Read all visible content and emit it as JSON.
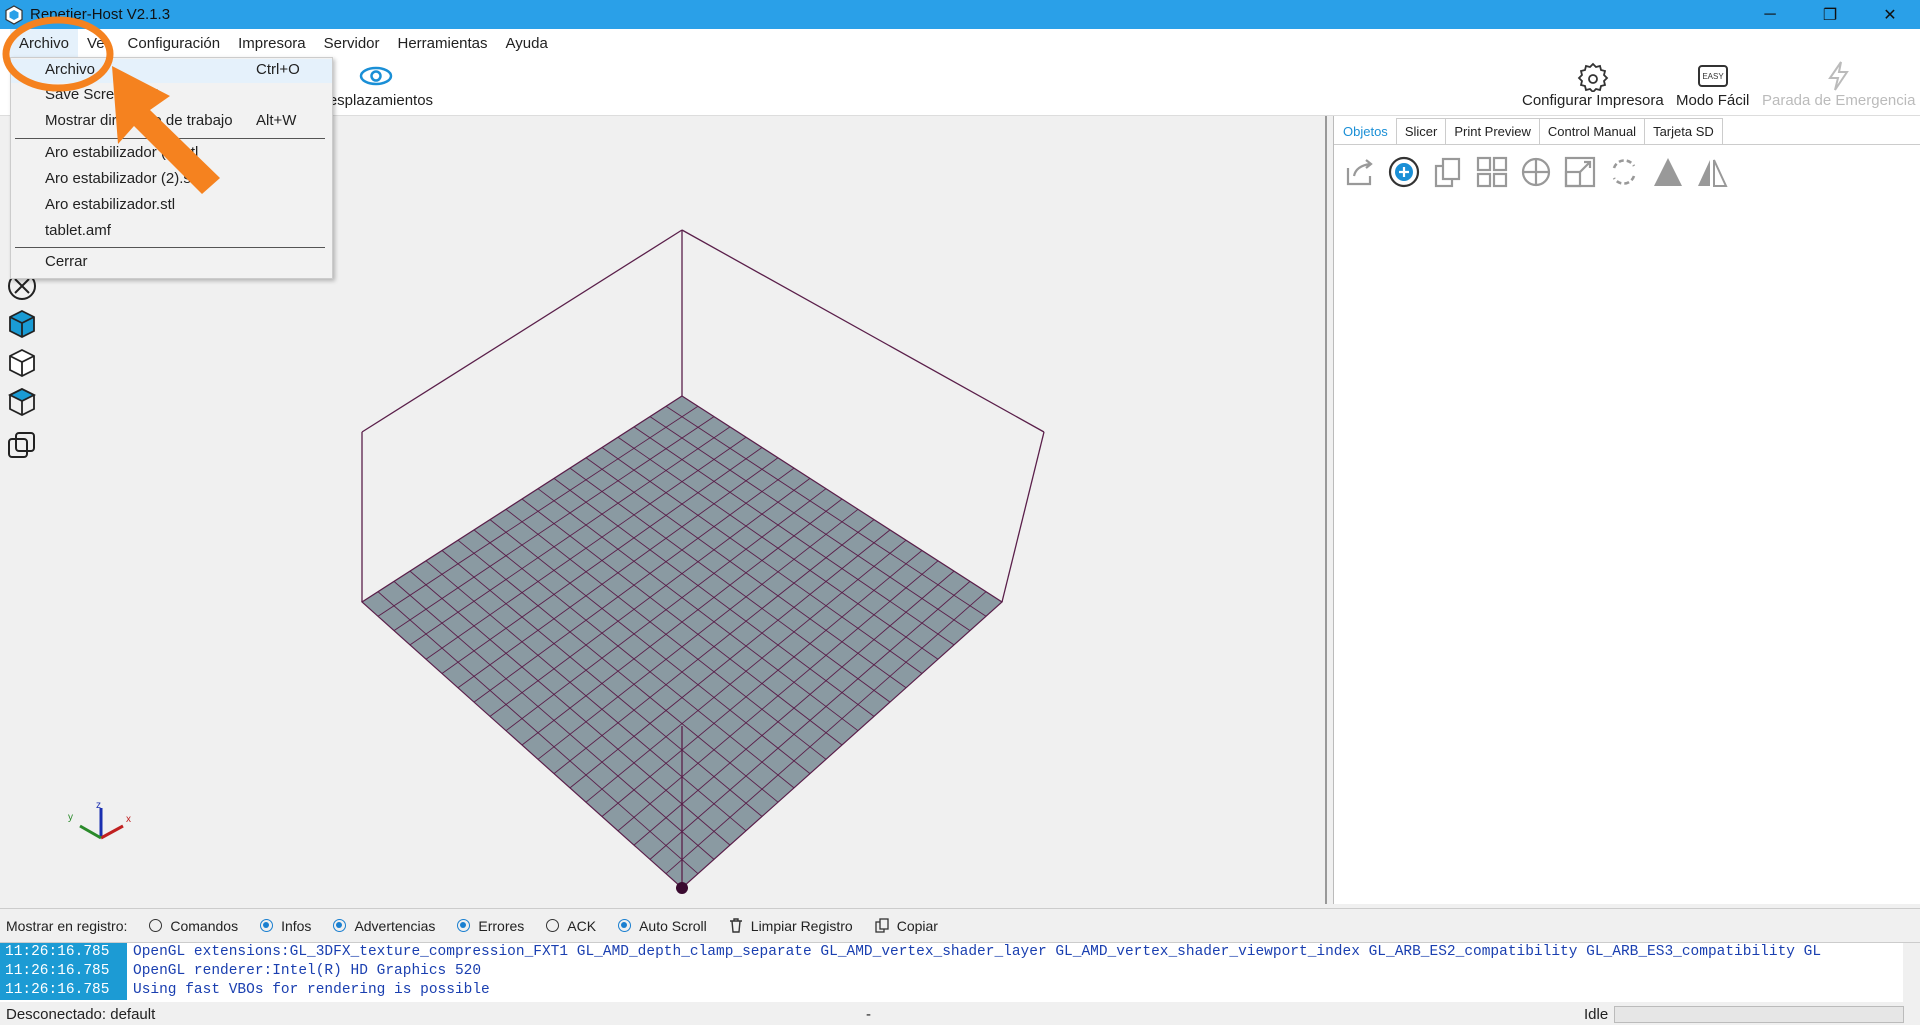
{
  "window": {
    "title": "Repetier-Host V2.1.3",
    "controls": [
      "─",
      "❐",
      "✕"
    ]
  },
  "menubar": {
    "items": [
      "Archivo",
      "Ver",
      "Configuración",
      "Impresora",
      "Servidor",
      "Herramientas",
      "Ayuda"
    ]
  },
  "toolbar": {
    "desplazamientos": "Desplazamientos",
    "configurar_impresora": "Configurar Impresora",
    "modo_facil": "Modo Fácil",
    "modo_facil_icon_text": "EASY",
    "parada_emergencia": "Parada de Emergencia"
  },
  "file_menu": {
    "items": [
      {
        "label": "Archivo",
        "shortcut": "Ctrl+O"
      },
      {
        "label": "Save Screenshot",
        "shortcut": ""
      },
      {
        "label": "Mostrar directorio de trabajo",
        "shortcut": "Alt+W"
      },
      {
        "label": "Aro estabilizador (3).stl",
        "shortcut": ""
      },
      {
        "label": "Aro estabilizador (2).stl",
        "shortcut": ""
      },
      {
        "label": "Aro estabilizador.stl",
        "shortcut": ""
      },
      {
        "label": "tablet.amf",
        "shortcut": ""
      },
      {
        "label": "Cerrar",
        "shortcut": ""
      }
    ]
  },
  "right_panel": {
    "tabs": [
      "Objetos",
      "Slicer",
      "Print Preview",
      "Control Manual",
      "Tarjeta SD"
    ],
    "active_tab": "Objetos"
  },
  "log_options": {
    "label": "Mostrar en registro:",
    "comandos": "Comandos",
    "infos": "Infos",
    "advertencias": "Advertencias",
    "errores": "Errores",
    "ack": "ACK",
    "auto_scroll": "Auto Scroll",
    "limpiar": "Limpiar Registro",
    "copiar": "Copiar",
    "states": {
      "comandos": false,
      "infos": true,
      "advertencias": true,
      "errores": true,
      "ack": false,
      "auto_scroll": true
    }
  },
  "log": [
    {
      "time": "11:26:16.785",
      "msg": "OpenGL extensions:GL_3DFX_texture_compression_FXT1 GL_AMD_depth_clamp_separate GL_AMD_vertex_shader_layer GL_AMD_vertex_shader_viewport_index GL_ARB_ES2_compatibility GL_ARB_ES3_compatibility GL"
    },
    {
      "time": "11:26:16.785",
      "msg": "OpenGL renderer:Intel(R) HD Graphics 520"
    },
    {
      "time": "11:26:16.785",
      "msg": "Using fast VBOs for rendering is possible"
    }
  ],
  "status": {
    "connection": "Desconectado: default",
    "middle": "-",
    "state": "Idle"
  },
  "colors": {
    "titlebar": "#2aa0e8",
    "accent": "#1a8fd6",
    "annotation": "#f5821f",
    "bed": "#8a9aa2",
    "frame": "#5a1f4a"
  }
}
